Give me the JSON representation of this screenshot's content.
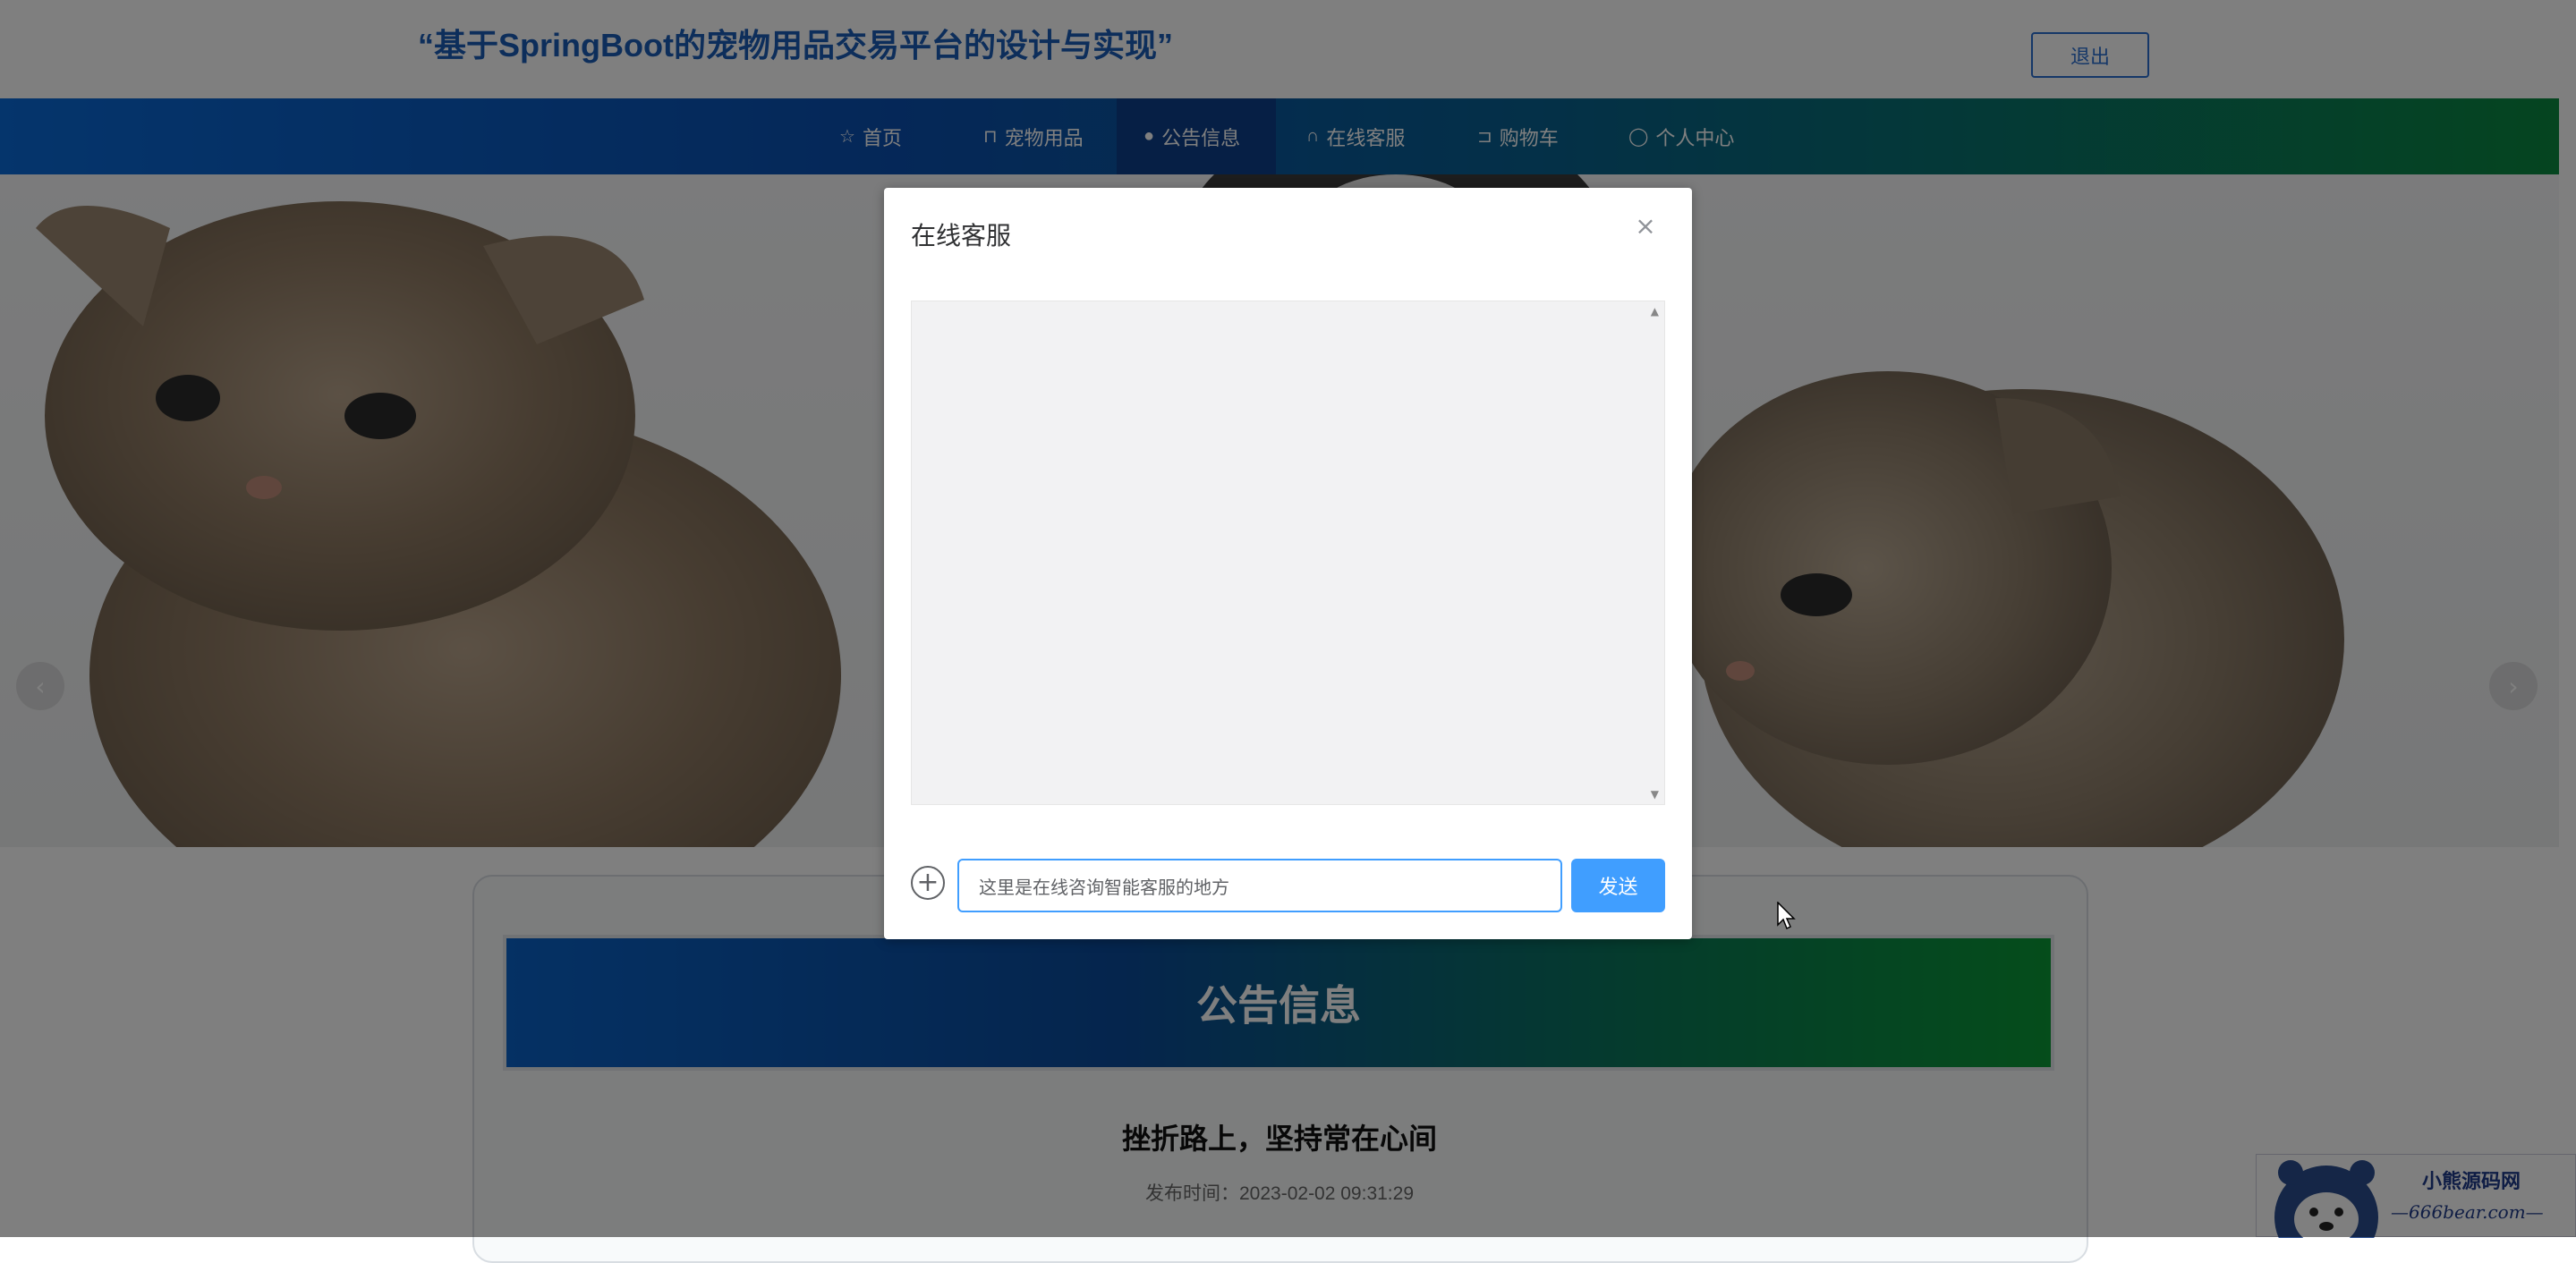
{
  "header": {
    "site_title": "“基于SpringBoot的宠物用品交易平台的设计与实现”",
    "logout_label": "退出"
  },
  "nav": {
    "items": [
      {
        "label": "首页",
        "icon": "star-icon",
        "glyph": "☆"
      },
      {
        "label": "宠物用品",
        "icon": "bag-icon",
        "glyph": "⊓"
      },
      {
        "label": "公告信息",
        "icon": "info-icon",
        "glyph": "●"
      },
      {
        "label": "在线客服",
        "icon": "headset-icon",
        "glyph": "∩"
      },
      {
        "label": "购物车",
        "icon": "cart-icon",
        "glyph": "⊐"
      },
      {
        "label": "个人中心",
        "icon": "user-icon",
        "glyph": "◯"
      }
    ],
    "active": "公告信息"
  },
  "banner": {
    "prev_glyph": "‹",
    "next_glyph": "›"
  },
  "notice": {
    "header": "公告信息",
    "article_title": "挫折路上，坚持常在心间",
    "publish_time": "发布时间：2023-02-02 09:31:29"
  },
  "dialog": {
    "title": "在线客服",
    "close_glyph": "×",
    "plus_glyph": "+",
    "input_value": "这里是在线咨询智能客服的地方",
    "send_label": "发送"
  },
  "watermark": {
    "line1": "小熊源码网",
    "line2": "—666bear.com—"
  },
  "colors": {
    "accent": "#409eff",
    "title_blue": "#1a5db6",
    "nav_active": "#0c3f8a"
  }
}
